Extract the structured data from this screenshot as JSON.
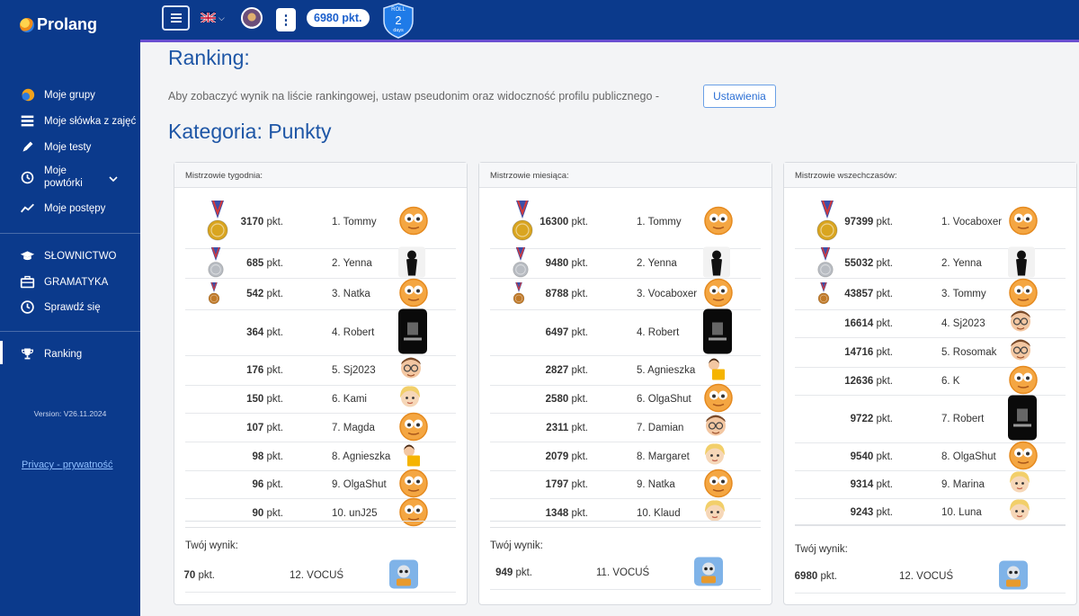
{
  "brand": {
    "name": "Prolang"
  },
  "sidebar": {
    "items": [
      {
        "label": "Moje grupy",
        "icon": "groups-icon"
      },
      {
        "label": "Moje słówka z zajęć",
        "icon": "table-list-icon"
      },
      {
        "label": "Moje testy",
        "icon": "pen-icon"
      },
      {
        "label": "Moje powtórki",
        "icon": "history-icon"
      },
      {
        "label": "Moje postępy",
        "icon": "chart-line-icon"
      },
      {
        "label": "SŁOWNICTWO",
        "icon": "graduation-cap-icon"
      },
      {
        "label": "GRAMATYKA",
        "icon": "briefcase-icon"
      },
      {
        "label": "Sprawdź się",
        "icon": "clock-icon"
      },
      {
        "label": "Ranking",
        "icon": "trophy-icon"
      }
    ],
    "version": "Version: V26.11.2024",
    "privacy": "Privacy - prywatność"
  },
  "topbar": {
    "points": "6980 pkt.",
    "roll_label": "ROLL",
    "roll_value": "2",
    "roll_unit": "days"
  },
  "page": {
    "title": "Ranking:",
    "info": "Aby zobaczyć wynik na liście rankingowej, ustaw pseudonim oraz widoczność profilu publicznego -",
    "settings_button": "Ustawienia",
    "category": "Kategoria: Punkty"
  },
  "pkt_suffix": "pkt.",
  "your_score_label": "Twój wynik:",
  "colors": {
    "primary": "#0b3a8c",
    "accent": "#1e56a6",
    "medal_gold": "#d9a520",
    "medal_silver": "#b8bcc2",
    "medal_bronze": "#c07a2a"
  },
  "cards": [
    {
      "title": "Mistrzowie tygodnia:",
      "rows": [
        {
          "points": "3170",
          "name": "1. Tommy",
          "avatar": "emoji-face"
        },
        {
          "points": "685",
          "name": "2. Yenna",
          "avatar": "woman-silhouette"
        },
        {
          "points": "542",
          "name": "3. Natka",
          "avatar": "emoji-face"
        },
        {
          "points": "364",
          "name": "4. Robert",
          "avatar": "phone-poster"
        },
        {
          "points": "176",
          "name": "5. Sj2023",
          "avatar": "man-glasses"
        },
        {
          "points": "150",
          "name": "6. Kami",
          "avatar": "blonde-girl"
        },
        {
          "points": "107",
          "name": "7. Magda",
          "avatar": "emoji-face"
        },
        {
          "points": "98",
          "name": "8. Agnieszka",
          "avatar": "reading-girl"
        },
        {
          "points": "96",
          "name": "9. OlgaShut",
          "avatar": "emoji-face"
        },
        {
          "points": "90",
          "name": "10. unJ25",
          "avatar": "emoji-face"
        }
      ],
      "you": {
        "points": "70",
        "name": "12. VOCUŚ",
        "avatar": "robot-app"
      }
    },
    {
      "title": "Mistrzowie miesiąca:",
      "rows": [
        {
          "points": "16300",
          "name": "1. Tommy",
          "avatar": "emoji-face"
        },
        {
          "points": "9480",
          "name": "2. Yenna",
          "avatar": "woman-silhouette"
        },
        {
          "points": "8788",
          "name": "3. Vocaboxer",
          "avatar": "emoji-face"
        },
        {
          "points": "6497",
          "name": "4. Robert",
          "avatar": "phone-poster"
        },
        {
          "points": "2827",
          "name": "5. Agnieszka",
          "avatar": "reading-girl"
        },
        {
          "points": "2580",
          "name": "6. OlgaShut",
          "avatar": "emoji-face"
        },
        {
          "points": "2311",
          "name": "7. Damian",
          "avatar": "man-glasses"
        },
        {
          "points": "2079",
          "name": "8. Margaret",
          "avatar": "blonde-girl"
        },
        {
          "points": "1797",
          "name": "9. Natka",
          "avatar": "emoji-face"
        },
        {
          "points": "1348",
          "name": "10. Klaud",
          "avatar": "blonde-girl"
        }
      ],
      "you": {
        "points": "949",
        "name": "11. VOCUŚ",
        "avatar": "robot-app"
      }
    },
    {
      "title": "Mistrzowie wszechczasów:",
      "rows": [
        {
          "points": "97399",
          "name": "1. Vocaboxer",
          "avatar": "emoji-face"
        },
        {
          "points": "55032",
          "name": "2. Yenna",
          "avatar": "woman-silhouette"
        },
        {
          "points": "43857",
          "name": "3. Tommy",
          "avatar": "emoji-face"
        },
        {
          "points": "16614",
          "name": "4. Sj2023",
          "avatar": "man-glasses"
        },
        {
          "points": "14716",
          "name": "5. Rosomak",
          "avatar": "man-glasses"
        },
        {
          "points": "12636",
          "name": "6. K",
          "avatar": "emoji-face"
        },
        {
          "points": "9722",
          "name": "7. Robert",
          "avatar": "phone-poster"
        },
        {
          "points": "9540",
          "name": "8. OlgaShut",
          "avatar": "emoji-face"
        },
        {
          "points": "9314",
          "name": "9. Marina",
          "avatar": "blonde-girl"
        },
        {
          "points": "9243",
          "name": "10. Luna",
          "avatar": "blonde-girl"
        }
      ],
      "you": {
        "points": "6980",
        "name": "12. VOCUŚ",
        "avatar": "robot-app"
      }
    }
  ]
}
